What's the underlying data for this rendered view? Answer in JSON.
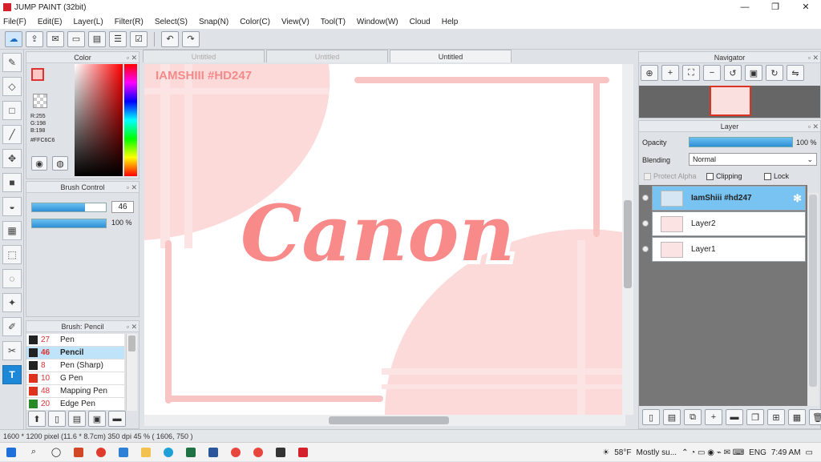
{
  "app": {
    "title": "JUMP PAINT (32bit)"
  },
  "menu": [
    "File(F)",
    "Edit(E)",
    "Layer(L)",
    "Filter(R)",
    "Select(S)",
    "Snap(N)",
    "Color(C)",
    "View(V)",
    "Tool(T)",
    "Window(W)",
    "Cloud",
    "Help"
  ],
  "color_panel": {
    "title": "Color",
    "r": "R:255",
    "g": "G:198",
    "b": "B:198",
    "hex": "#FFC6C6",
    "primary_color": "#ffc6c6"
  },
  "brush_control": {
    "title": "Brush Control",
    "size_value": "46",
    "opacity_value": "100 %",
    "size_fraction": 0.72,
    "opacity_fraction": 1.0
  },
  "brush_list": {
    "title": "Brush: Pencil",
    "items": [
      {
        "num": "27",
        "name": "Pen",
        "color": "#222222"
      },
      {
        "num": "46",
        "name": "Pencil",
        "color": "#222222"
      },
      {
        "num": "8",
        "name": "Pen (Sharp)",
        "color": "#222222"
      },
      {
        "num": "10",
        "name": "G Pen",
        "color": "#e0301e"
      },
      {
        "num": "48",
        "name": "Mapping Pen",
        "color": "#e0301e"
      },
      {
        "num": "20",
        "name": "Edge Pen",
        "color": "#2a8a2a"
      }
    ]
  },
  "tabs": [
    "Untitled",
    "Untitled",
    "Untitled"
  ],
  "canvas": {
    "watermark": "IAMSHIII #HD247",
    "art_text": "Canon"
  },
  "navigator": {
    "title": "Navigator"
  },
  "layer_panel": {
    "title": "Layer",
    "opacity_label": "Opacity",
    "opacity_value": "100 %",
    "blending_label": "Blending",
    "blending_value": "Normal",
    "protect_alpha": "Protect Alpha",
    "clipping": "Clipping",
    "lock": "Lock",
    "layers": [
      {
        "name": "IamShiii #hd247"
      },
      {
        "name": "Layer2"
      },
      {
        "name": "Layer1"
      }
    ]
  },
  "status": {
    "text": "1600 * 1200 pixel   (11.6 * 8.7cm)   350 dpi   45 %   ( 1606, 750 )"
  },
  "taskbar": {
    "weather_temp": "58°F",
    "weather_desc": "Mostly su...",
    "language": "ENG",
    "time": "7:49 AM"
  }
}
